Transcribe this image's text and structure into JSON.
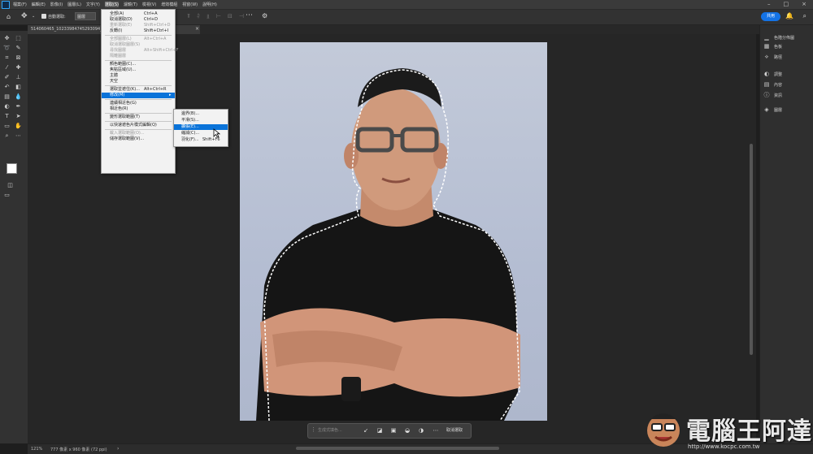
{
  "menubar": {
    "items": [
      "檔案(F)",
      "編輯(E)",
      "影像(I)",
      "圖層(L)",
      "文字(Y)",
      "選取(S)",
      "濾鏡(T)",
      "檢視(V)",
      "增效模組",
      "視窗(W)",
      "說明(H)"
    ],
    "active_index": 5
  },
  "options_bar": {
    "auto_select_label": "自動選取:",
    "auto_select_value": "圖層",
    "share_label": "共用"
  },
  "document_tab": {
    "title": "514060465_10233984745293094_7... (RGB/8) *"
  },
  "select_menu": {
    "items": [
      {
        "label": "全部(A)",
        "shortcut": "Ctrl+A",
        "disabled": false
      },
      {
        "label": "取消選取(D)",
        "shortcut": "Ctrl+D",
        "disabled": false
      },
      {
        "label": "重新選取(E)",
        "shortcut": "Shift+Ctrl+D",
        "disabled": true
      },
      {
        "label": "反轉(I)",
        "shortcut": "Shift+Ctrl+I",
        "disabled": false
      },
      {
        "sep": true
      },
      {
        "label": "全部圖層(L)",
        "shortcut": "Alt+Ctrl+A",
        "disabled": true
      },
      {
        "label": "取消選取圖層(S)",
        "shortcut": "",
        "disabled": true
      },
      {
        "label": "尋找圖層",
        "shortcut": "Alt+Shift+Ctrl+F",
        "disabled": true
      },
      {
        "label": "隔離圖層",
        "shortcut": "",
        "disabled": true
      },
      {
        "sep": true
      },
      {
        "label": "顏色範圍(C)...",
        "shortcut": "",
        "disabled": false
      },
      {
        "label": "焦點區域(U)...",
        "shortcut": "",
        "disabled": false
      },
      {
        "label": "主體",
        "shortcut": "",
        "disabled": false
      },
      {
        "label": "天空",
        "shortcut": "",
        "disabled": false
      },
      {
        "sep": true
      },
      {
        "label": "選取並遮住(K)...",
        "shortcut": "Alt+Ctrl+R",
        "disabled": false
      },
      {
        "label": "修改(M)",
        "shortcut": "",
        "disabled": false,
        "highlight": true,
        "submenu": true
      },
      {
        "sep": true
      },
      {
        "label": "連續相近色(G)",
        "shortcut": "",
        "disabled": false
      },
      {
        "label": "相近色(R)",
        "shortcut": "",
        "disabled": false
      },
      {
        "sep": true
      },
      {
        "label": "變形選取範圍(T)",
        "shortcut": "",
        "disabled": false
      },
      {
        "sep": true
      },
      {
        "label": "以快速遮色片模式編輯(Q)",
        "shortcut": "",
        "disabled": false
      },
      {
        "sep": true
      },
      {
        "label": "載入選取範圍(O)...",
        "shortcut": "",
        "disabled": true
      },
      {
        "label": "儲存選取範圍(V)...",
        "shortcut": "",
        "disabled": false
      }
    ]
  },
  "modify_submenu": {
    "items": [
      {
        "label": "邊界(B)...",
        "shortcut": ""
      },
      {
        "label": "平滑(S)...",
        "shortcut": ""
      },
      {
        "label": "擴張(E)...",
        "shortcut": "",
        "highlight": true
      },
      {
        "label": "縮減(C)...",
        "shortcut": ""
      },
      {
        "label": "羽化(F)...",
        "shortcut": "Shift+F6"
      }
    ]
  },
  "right_panel": {
    "items": [
      {
        "label": "色階分佈圖",
        "icon": "histogram-icon"
      },
      {
        "label": "色板",
        "icon": "swatches-icon"
      },
      {
        "label": "路徑",
        "icon": "paths-icon"
      },
      {
        "label": "調整",
        "icon": "adjustments-icon"
      },
      {
        "label": "內容",
        "icon": "properties-icon"
      },
      {
        "label": "資訊",
        "icon": "info-icon"
      },
      {
        "label": "圖層",
        "icon": "layers-icon"
      }
    ]
  },
  "context_bar": {
    "generative_fill_label": "生成式填色...",
    "deselect_label": "取消選取"
  },
  "status_bar": {
    "zoom": "121%",
    "doc_info": "777 像素 x 960 像素 (72 ppi)"
  },
  "watermark": {
    "text": "電腦王阿達",
    "url": "http://www.kocpc.com.tw"
  }
}
